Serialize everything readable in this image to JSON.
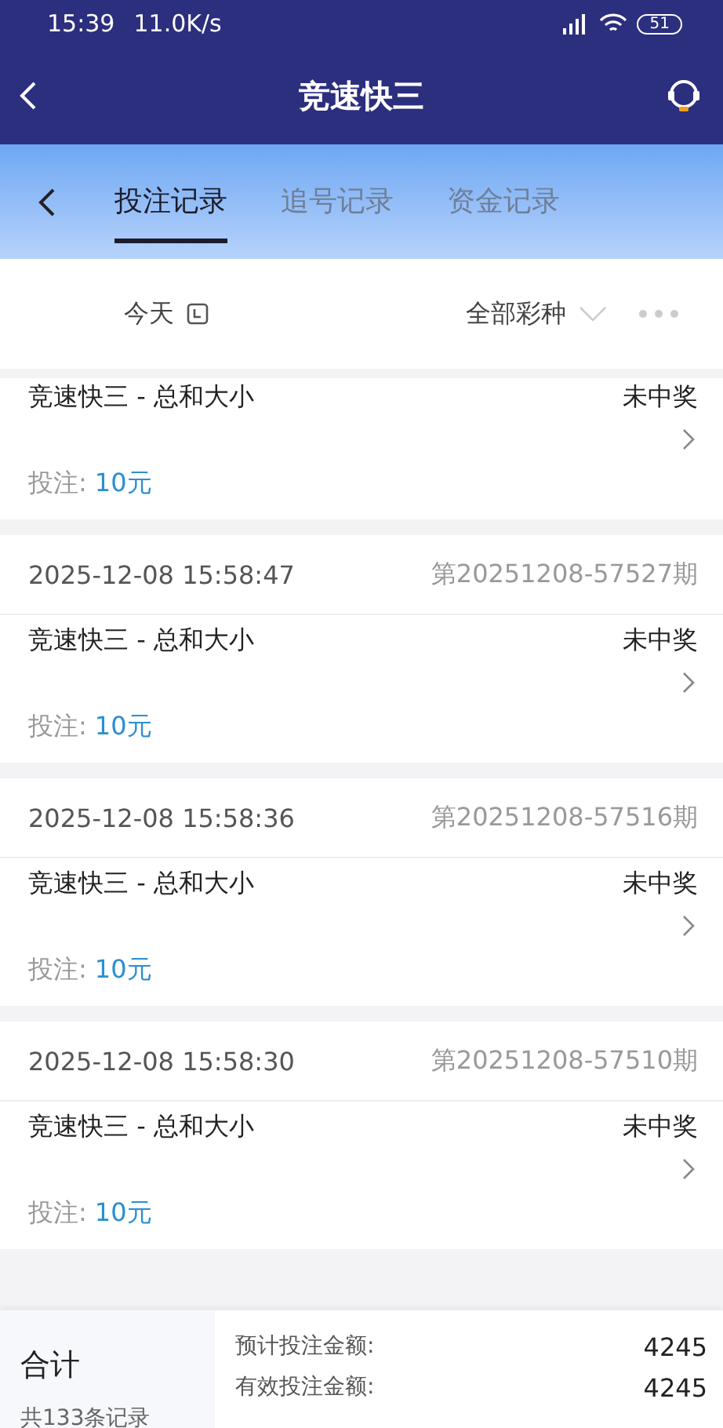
{
  "status_bar": {
    "time": "15:39",
    "speed": "11.0K/s",
    "battery": "51"
  },
  "header": {
    "title": "竞速快三"
  },
  "tabs": [
    {
      "label": "投注记录",
      "selected": true
    },
    {
      "label": "追号记录",
      "selected": false
    },
    {
      "label": "资金记录",
      "selected": false
    }
  ],
  "filter": {
    "date": "今天",
    "lottery": "全部彩种"
  },
  "records": [
    {
      "game": "竞速快三 - 总和大小",
      "result": "未中奖",
      "bet_label": "投注:",
      "amount": "10元"
    },
    {
      "date": "2025-12-08 15:58:47",
      "period": "第20251208-57527期",
      "game": "竞速快三 - 总和大小",
      "result": "未中奖",
      "bet_label": "投注:",
      "amount": "10元"
    },
    {
      "date": "2025-12-08 15:58:36",
      "period": "第20251208-57516期",
      "game": "竞速快三 - 总和大小",
      "result": "未中奖",
      "bet_label": "投注:",
      "amount": "10元"
    },
    {
      "date": "2025-12-08 15:58:30",
      "period": "第20251208-57510期",
      "game": "竞速快三 - 总和大小",
      "result": "未中奖",
      "bet_label": "投注:",
      "amount": "10元"
    }
  ],
  "summary": {
    "title": "合计",
    "count": "共133条记录",
    "rows": [
      {
        "label": "预计投注金额:",
        "value": "4245"
      },
      {
        "label": "有效投注金额:",
        "value": "4245"
      }
    ]
  }
}
